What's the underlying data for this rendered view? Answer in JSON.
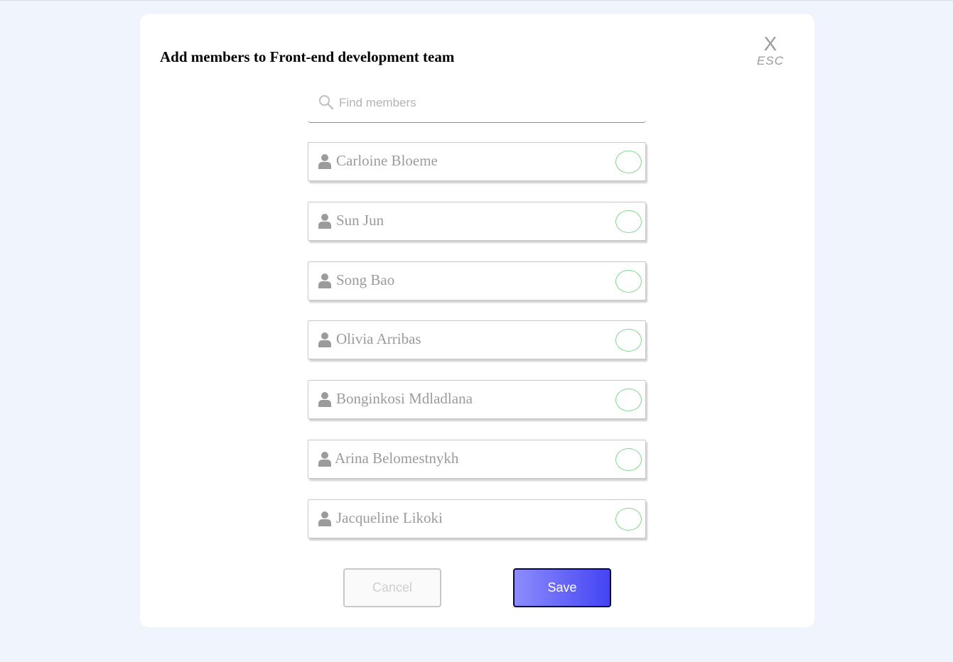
{
  "modal": {
    "title": "Add members to Front-end development team",
    "close_label": "X",
    "close_hint": "ESC"
  },
  "search": {
    "placeholder": "Find members",
    "value": "",
    "icon": "search-icon"
  },
  "members": [
    {
      "name": "Carloine Bloeme",
      "icon": "user-icon",
      "selected": false
    },
    {
      "name": "Sun Jun",
      "icon": "user-icon",
      "selected": false
    },
    {
      "name": "Song Bao",
      "icon": "user-icon",
      "selected": false
    },
    {
      "name": "Olivia Arribas",
      "icon": "user-icon",
      "selected": false
    },
    {
      "name": "Bonginkosi Mdladlana",
      "icon": "user-icon",
      "selected": false
    },
    {
      "name": "Arina Belomestnykh",
      "icon": "user-icon",
      "selected": false
    },
    {
      "name": "Jacqueline Likoki",
      "icon": "user-icon",
      "selected": false
    }
  ],
  "actions": {
    "cancel_label": "Cancel",
    "save_label": "Save"
  },
  "colors": {
    "background": "#f0f5fd",
    "check_border": "#7fd88b",
    "save_gradient_start": "#8c8cfc",
    "save_gradient_end": "#4444f5"
  }
}
